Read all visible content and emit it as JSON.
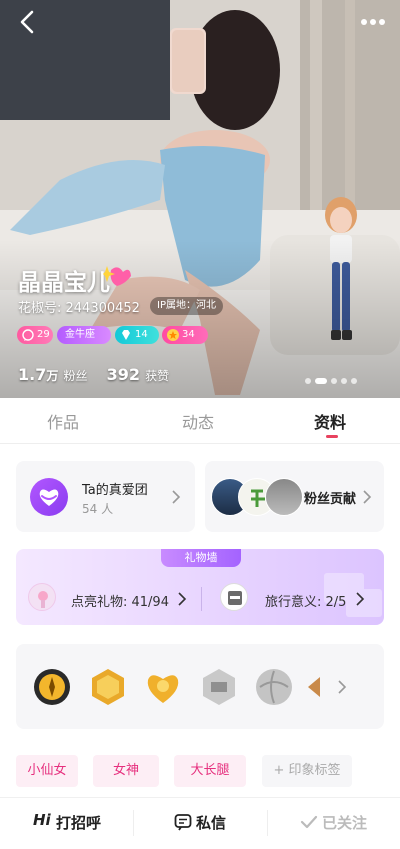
{
  "profile": {
    "name": "晶晶宝儿",
    "user_id": "花椒号: 244300452",
    "ip_location": "IP属地：河北",
    "badges": [
      {
        "label": "29",
        "icon": "chat-bubble-icon",
        "color": "#ff5aa0"
      },
      {
        "label": "金牛座",
        "icon": "zodiac",
        "color": "#b45cff"
      },
      {
        "label": "14",
        "icon": "diamond-icon",
        "color": "#14c9d8"
      },
      {
        "label": "34",
        "icon": "star-medal-icon",
        "color": "#ff4aa2"
      }
    ],
    "fans_num": "1.7",
    "fans_unit": "万",
    "fans_label": "粉丝",
    "likes_num": "392",
    "likes_label": "获赞",
    "carousel": {
      "total": 5,
      "active": 2
    }
  },
  "tabs": [
    {
      "label": "作品"
    },
    {
      "label": "动态"
    },
    {
      "label": "资料",
      "active": true
    }
  ],
  "fan_club": {
    "title": "Ta的真爱团",
    "count": "54 人"
  },
  "fan_contribution": {
    "title": "粉丝贡献"
  },
  "gift_wall": {
    "header": "礼物墙",
    "lit_gifts": "点亮礼物: 41/94",
    "travel_label": "旅行意义: 2/5"
  },
  "medals": [
    "gold-sun-medal-icon",
    "gold-hexagon-medal-icon",
    "gold-heart-medal-icon",
    "silver-travel-medal-icon",
    "silver-ball-medal-icon",
    "bronze-medal-icon"
  ],
  "tags": [
    "小仙女",
    "女神",
    "大长腿",
    "+ 印象标签"
  ],
  "bottom_bar": {
    "greet_prefix": "Hi",
    "greet": "打招呼",
    "message": "私信",
    "followed": "已关注"
  },
  "colors": {
    "accent": "#e8425f",
    "tag_text": "#e6307e",
    "tag_bg": "#fdeef5",
    "purple": "#a463ff"
  }
}
